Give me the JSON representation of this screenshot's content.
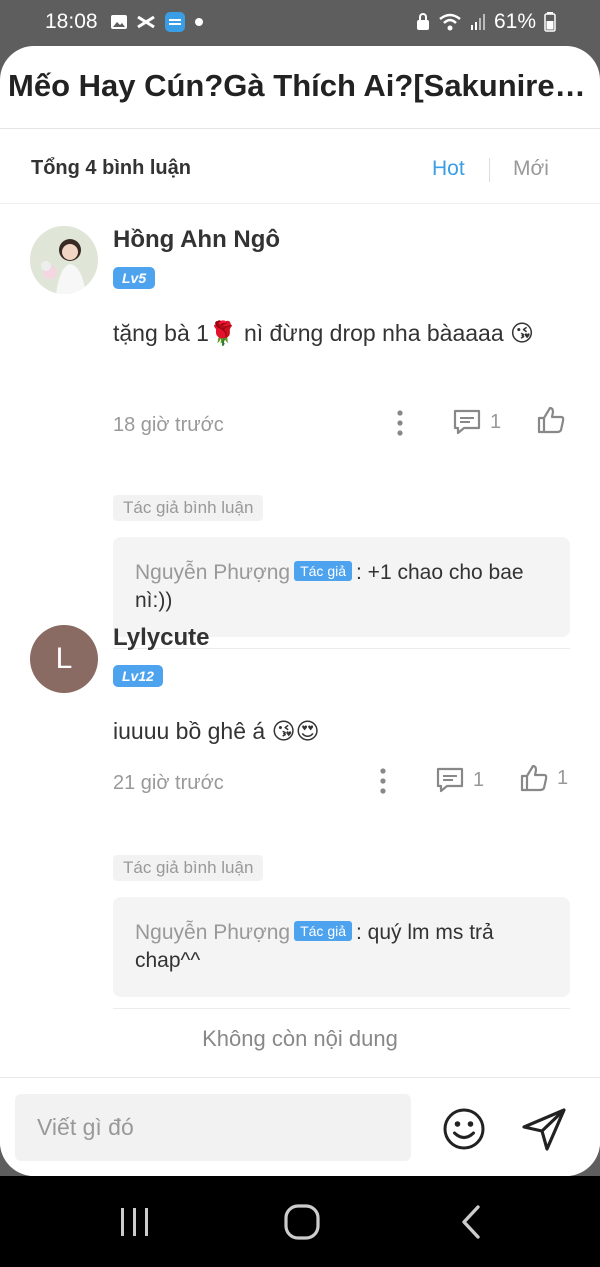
{
  "status_bar": {
    "time": "18:08",
    "battery": "61%"
  },
  "header": {
    "title": "Mếo Hay Cún?Gà Thích Ai?[Sakunirei…"
  },
  "sort": {
    "total": "Tổng 4 bình luận",
    "hot": "Hot",
    "new": "Mới"
  },
  "comments": [
    {
      "user": "Hồng Ahn Ngô",
      "level": "Lv5",
      "content": "tặng bà 1🌹 nì đừng drop nha bàaaaa 😘",
      "time": "18 giờ trước",
      "reply_count": "1",
      "like_count": "",
      "author_tag": "Tác giả bình luận",
      "reply": {
        "name": "Nguyễn Phượng",
        "badge": "Tác giả",
        "text": ": +1 chao cho bae nì:))"
      }
    },
    {
      "user": "Lylycute",
      "avatar_letter": "L",
      "level": "Lv12",
      "content": "iuuuu bồ ghê á 😘😍",
      "time": "21 giờ trước",
      "reply_count": "1",
      "like_count": "1",
      "author_tag": "Tác giả bình luận",
      "reply": {
        "name": "Nguyễn Phượng",
        "badge": "Tác giả",
        "text": ": quý lm ms trả chap^^"
      }
    }
  ],
  "footer": {
    "no_more": "Không còn nội dung"
  },
  "input": {
    "placeholder": "Viết gì đó"
  },
  "colors": {
    "accent": "#3a9ee6",
    "level_badge": "#4ea3ef"
  }
}
